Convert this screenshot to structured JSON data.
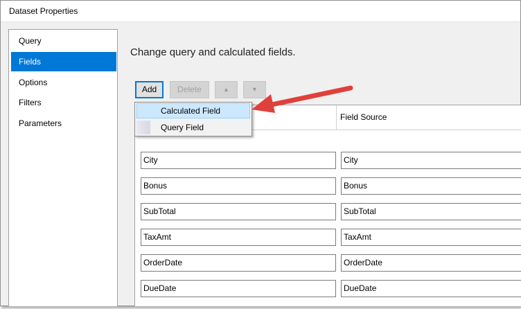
{
  "window": {
    "title": "Dataset Properties"
  },
  "nav": {
    "items": [
      {
        "label": "Query",
        "selected": false
      },
      {
        "label": "Fields",
        "selected": true
      },
      {
        "label": "Options",
        "selected": false
      },
      {
        "label": "Filters",
        "selected": false
      },
      {
        "label": "Parameters",
        "selected": false
      }
    ]
  },
  "main": {
    "heading": "Change query and calculated fields.",
    "toolbar": {
      "add_label": "Add",
      "delete_label": "Delete",
      "move_up_icon": "arrow-up-icon",
      "move_down_icon": "arrow-down-icon"
    },
    "grid": {
      "columns": [
        "",
        "Field Source"
      ],
      "rows": [
        {
          "name": "City",
          "source": "City"
        },
        {
          "name": "Bonus",
          "source": "Bonus"
        },
        {
          "name": "SubTotal",
          "source": "SubTotal"
        },
        {
          "name": "TaxAmt",
          "source": "TaxAmt"
        },
        {
          "name": "OrderDate",
          "source": "OrderDate"
        },
        {
          "name": "DueDate",
          "source": "DueDate"
        }
      ]
    }
  },
  "add_menu": {
    "items": [
      {
        "label": "Calculated Field",
        "highlighted": true
      },
      {
        "label": "Query Field",
        "highlighted": false
      }
    ]
  },
  "annotation": {
    "arrow_color": "#e0403a",
    "points_to": "Calculated Field"
  },
  "colors": {
    "selection": "#0078d7",
    "menu_hover": "#cce8ff"
  }
}
